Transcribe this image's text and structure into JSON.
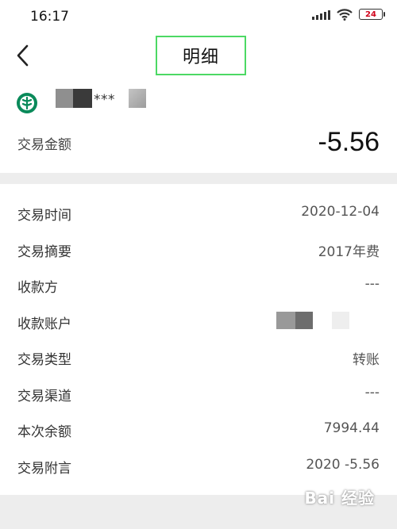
{
  "status_bar": {
    "time": "16:17",
    "battery_level": "24",
    "icons": [
      "signal-icon",
      "wifi-icon",
      "battery-icon"
    ]
  },
  "nav": {
    "back_icon": "chevron-left-icon",
    "title": "明细",
    "title_highlight_color": "#4cd964"
  },
  "account": {
    "bank_logo": "bank-logo-icon",
    "logo_color": "#0a8a5a",
    "masked_number": "***"
  },
  "summary": {
    "amount_label": "交易金额",
    "amount_value": "-5.56"
  },
  "details": [
    {
      "label": "交易时间",
      "value": "2020-12-04"
    },
    {
      "label": "交易摘要",
      "value": "2017年费"
    },
    {
      "label": "收款方",
      "value": "---"
    },
    {
      "label": "收款账户",
      "value": ""
    },
    {
      "label": "交易类型",
      "value": "转账"
    },
    {
      "label": "交易渠道",
      "value": "---"
    },
    {
      "label": "本次余额",
      "value": "7994.44"
    },
    {
      "label": "交易附言",
      "value": "2020 -5.56"
    }
  ],
  "watermark": "Bai 经验"
}
